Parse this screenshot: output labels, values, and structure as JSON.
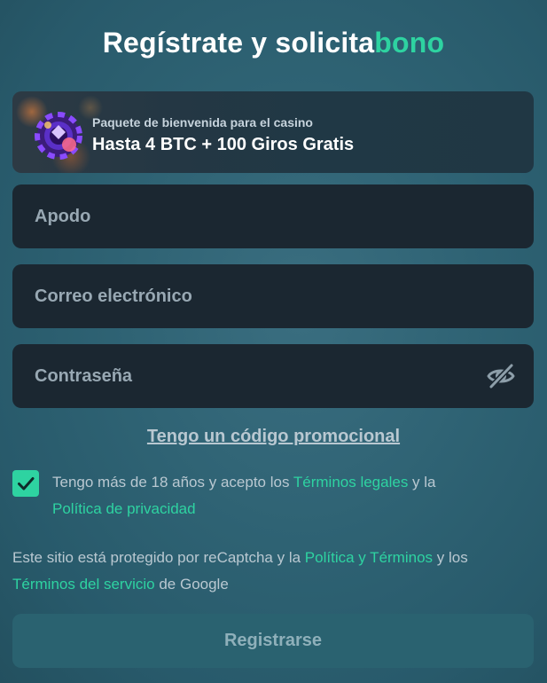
{
  "header": {
    "title_main": "Regístrate y solicita",
    "title_accent": "bono"
  },
  "promo_banner": {
    "icon": "casino-chip-icon",
    "subtitle": "Paquete de bienvenida para el casino",
    "headline": "Hasta 4 BTC + 100 Giros Gratis"
  },
  "form": {
    "nickname": {
      "placeholder": "Apodo",
      "value": ""
    },
    "email": {
      "placeholder": "Correo electrónico",
      "value": ""
    },
    "password": {
      "placeholder": "Contraseña",
      "value": "",
      "toggle_icon": "eye-slash-icon"
    },
    "promo_code_link": "Tengo un código promocional",
    "consent": {
      "checked": true,
      "text_1": "Tengo más de 18 años y acepto los ",
      "link_terms": "Términos legales",
      "text_2": " y la ",
      "link_privacy": "Política de privacidad"
    },
    "recaptcha": {
      "text_1": "Este sitio está protegido por reCaptcha y la ",
      "link_policy": "Política y Términos",
      "text_2": " y los ",
      "link_service": "Términos del servicio",
      "text_3": " de Google"
    },
    "submit_label": "Registrarse"
  },
  "colors": {
    "accent": "#2ed3a1",
    "background": "#2e6273",
    "field_background": "#1b2731",
    "button_background": "#2a6270"
  }
}
